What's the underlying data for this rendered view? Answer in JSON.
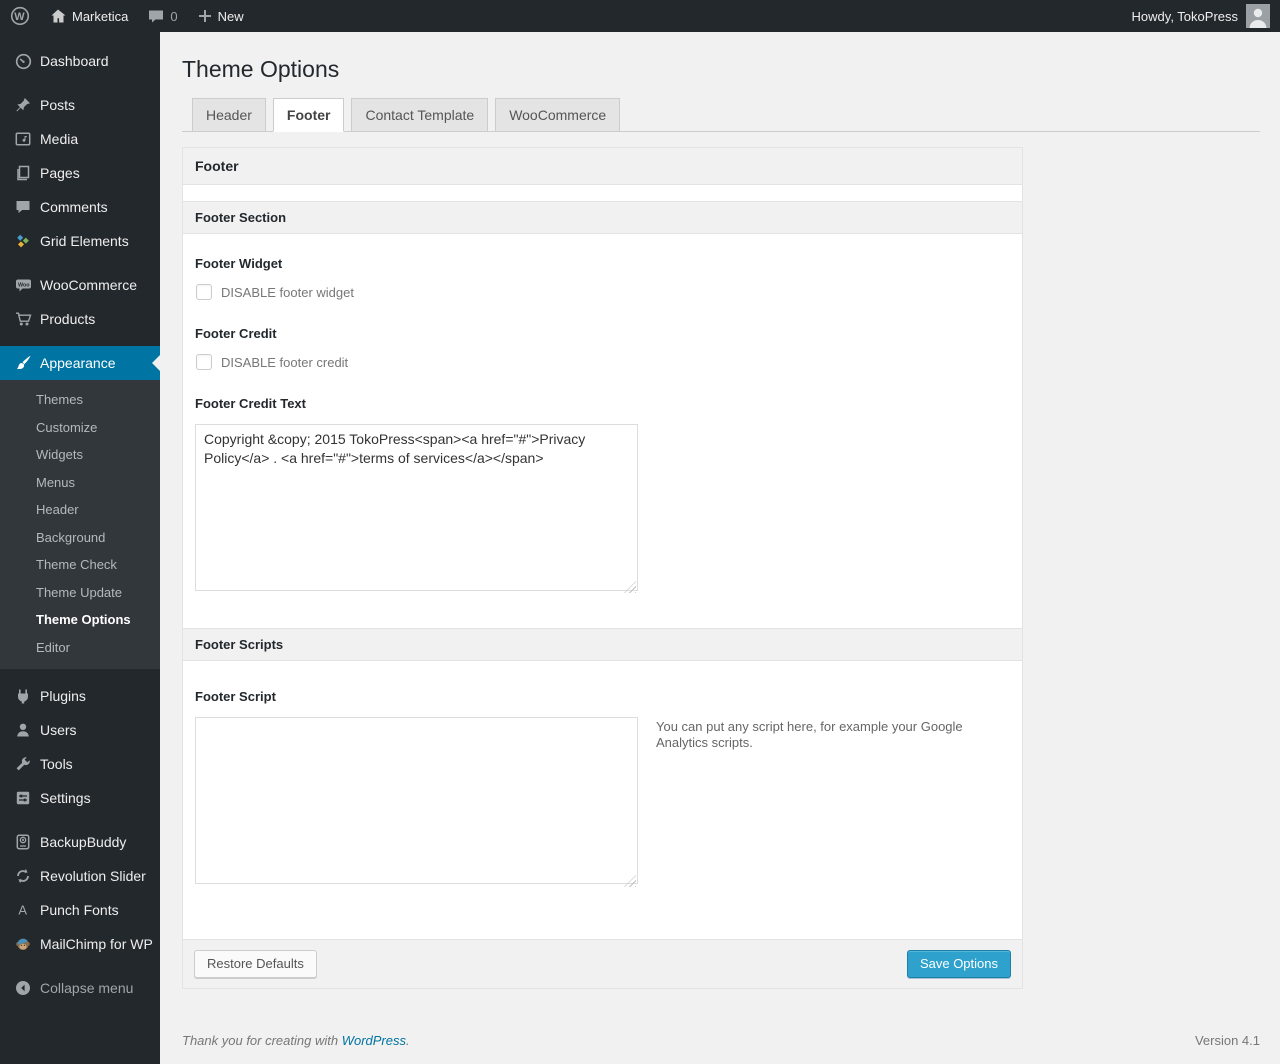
{
  "colors": {
    "accent": "#0074a2",
    "primary_button": "#2ea2cc",
    "admin_dark": "#23282d",
    "page_background": "#f1f1f1"
  },
  "admin_bar": {
    "site_name": "Marketica",
    "comment_count": "0",
    "new_label": "New",
    "howdy": "Howdy, TokoPress"
  },
  "sidebar": {
    "items": [
      {
        "label": "Dashboard",
        "icon": "dashboard-icon"
      },
      {
        "label": "Posts",
        "icon": "pushpin-icon"
      },
      {
        "label": "Media",
        "icon": "media-icon"
      },
      {
        "label": "Pages",
        "icon": "pages-icon"
      },
      {
        "label": "Comments",
        "icon": "comment-icon"
      },
      {
        "label": "Grid Elements",
        "icon": "grid-elements-icon"
      },
      {
        "label": "WooCommerce",
        "icon": "woocommerce-icon"
      },
      {
        "label": "Products",
        "icon": "cart-icon"
      },
      {
        "label": "Appearance",
        "icon": "paintbrush-icon",
        "active": true
      },
      {
        "label": "Plugins",
        "icon": "plugin-icon"
      },
      {
        "label": "Users",
        "icon": "user-icon"
      },
      {
        "label": "Tools",
        "icon": "wrench-icon"
      },
      {
        "label": "Settings",
        "icon": "sliders-icon"
      },
      {
        "label": "BackupBuddy",
        "icon": "backup-icon"
      },
      {
        "label": "Revolution Slider",
        "icon": "refresh-icon"
      },
      {
        "label": "Punch Fonts",
        "icon": "letter-a-icon"
      },
      {
        "label": "MailChimp for WP",
        "icon": "monkey-icon"
      }
    ],
    "appearance_submenu": [
      {
        "label": "Themes"
      },
      {
        "label": "Customize"
      },
      {
        "label": "Widgets"
      },
      {
        "label": "Menus"
      },
      {
        "label": "Header"
      },
      {
        "label": "Background"
      },
      {
        "label": "Theme Check"
      },
      {
        "label": "Theme Update"
      },
      {
        "label": "Theme Options",
        "current": true
      },
      {
        "label": "Editor"
      }
    ],
    "collapse_label": "Collapse menu"
  },
  "page": {
    "title": "Theme Options",
    "tabs": [
      {
        "label": "Header",
        "active": false
      },
      {
        "label": "Footer",
        "active": true
      },
      {
        "label": "Contact Template",
        "active": false
      },
      {
        "label": "WooCommerce",
        "active": false
      }
    ]
  },
  "panel": {
    "title": "Footer",
    "section1": {
      "heading": "Footer Section",
      "footer_widget": {
        "label": "Footer Widget",
        "checkbox_label": "DISABLE footer widget",
        "checked": false
      },
      "footer_credit": {
        "label": "Footer Credit",
        "checkbox_label": "DISABLE footer credit",
        "checked": false
      },
      "footer_credit_text": {
        "label": "Footer Credit Text",
        "value": "Copyright &copy; 2015 TokoPress<span><a href=\"#\">Privacy Policy</a> . <a href=\"#\">terms of services</a></span>"
      }
    },
    "section2": {
      "heading": "Footer Scripts",
      "footer_script": {
        "label": "Footer Script",
        "value": "",
        "help": "You can put any script here, for example your Google Analytics scripts."
      }
    },
    "restore_button": "Restore Defaults",
    "save_button": "Save Options"
  },
  "page_footer": {
    "thanks_prefix": "Thank you for creating with ",
    "wordpress_link": "WordPress",
    "thanks_suffix": ".",
    "version": "Version 4.1"
  }
}
